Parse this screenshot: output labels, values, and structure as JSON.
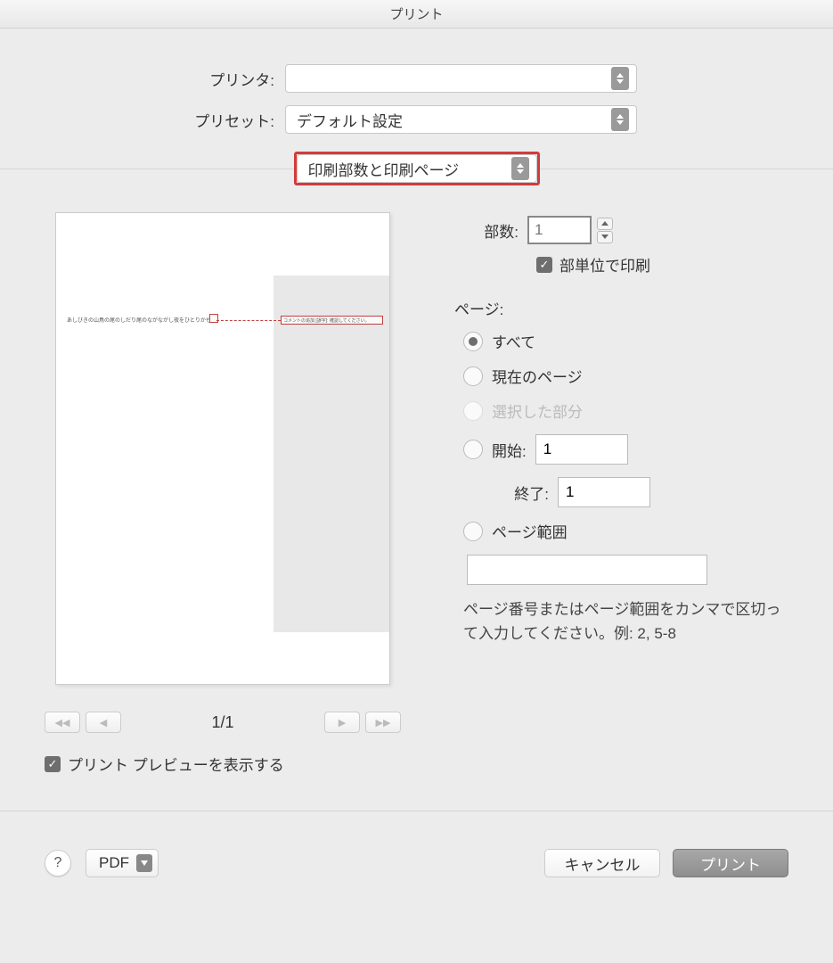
{
  "window": {
    "title": "プリント"
  },
  "printer": {
    "label": "プリンタ:",
    "value": ""
  },
  "preset": {
    "label": "プリセット:",
    "value": "デフォルト設定"
  },
  "section": {
    "value": "印刷部数と印刷ページ"
  },
  "copies": {
    "label": "部数:",
    "value": "1",
    "collate_label": "部単位で印刷",
    "collate_checked": true
  },
  "pages": {
    "label": "ページ:",
    "options": {
      "all": "すべて",
      "current": "現在のページ",
      "selection": "選択した部分",
      "from": "開始:",
      "to": "終了:",
      "range": "ページ範囲"
    },
    "selected": "all",
    "from_value": "1",
    "to_value": "1",
    "range_value": "",
    "hint": "ページ番号またはページ範囲をカンマで区切って入力してください。例: 2, 5-8"
  },
  "preview": {
    "page_indicator": "1/1",
    "show_label": "プリント プレビューを表示する",
    "show_checked": true,
    "sample_text": "あしびきの山鳥の尾のしだり尾のながながし夜をひとりかも",
    "comment_label": "コメントの追加 [誤字]: 確認してください。"
  },
  "footer": {
    "pdf": "PDF",
    "cancel": "キャンセル",
    "print": "プリント"
  }
}
